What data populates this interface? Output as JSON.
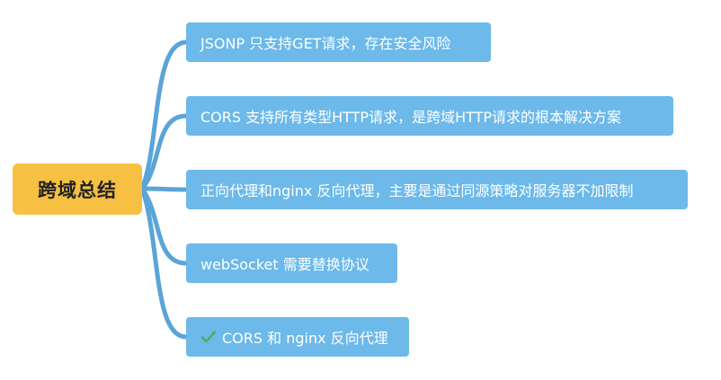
{
  "mindmap": {
    "root": {
      "label": "跨域总结"
    },
    "branches": [
      {
        "label": "JSONP 只支持GET请求，存在安全风险"
      },
      {
        "label": "CORS 支持所有类型HTTP请求，是跨域HTTP请求的根本解决方案"
      },
      {
        "label": "正向代理和nginx 反向代理，主要是通过同源策略对服务器不加限制"
      },
      {
        "label": "webSocket 需要替换协议"
      },
      {
        "label": "CORS 和 nginx 反向代理",
        "icon": "checkmark-icon"
      }
    ],
    "colors": {
      "root_fill": "#f6c042",
      "branch_fill": "#6cb9ea",
      "connector": "#5aa4d8",
      "check": "#4caf50"
    }
  }
}
